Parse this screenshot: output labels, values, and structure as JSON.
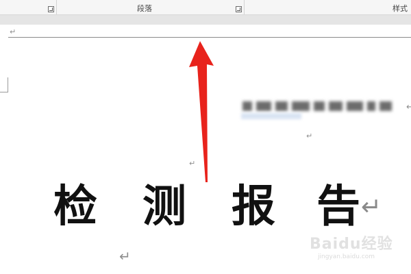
{
  "ribbon": {
    "groups": [
      {
        "label": ""
      },
      {
        "label": "段落"
      },
      {
        "label": "样式"
      }
    ]
  },
  "document": {
    "paragraph_mark": "↵",
    "blurred_text": "",
    "title_chars": [
      "检",
      "测",
      "报",
      "告"
    ],
    "title_end_mark": "↵"
  },
  "watermark": {
    "brand": "Baidu经验",
    "url": "jingyan.baidu.com"
  },
  "annotation": {
    "arrow_color": "#e8231c"
  }
}
